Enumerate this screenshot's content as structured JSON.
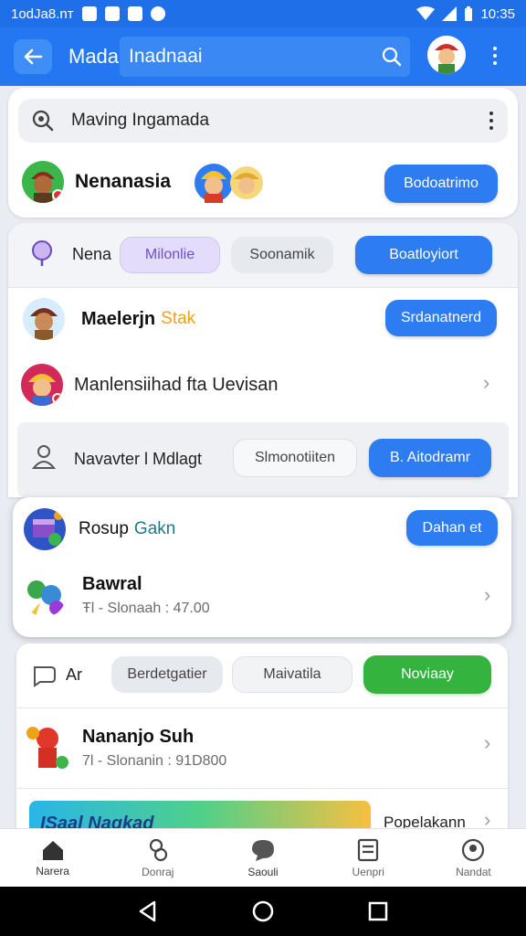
{
  "status_bar": {
    "left_text": "1odJa8.nт",
    "time": "10:35"
  },
  "app_bar": {
    "title": "Mada",
    "search_value": "Inadnaai"
  },
  "search": {
    "value": "Maving Ingamada"
  },
  "profile": {
    "name": "Nenanasia",
    "button": "Bodoatrimo"
  },
  "filters1": {
    "label": "Nena",
    "chip1": "Milonlie",
    "chip2": "Soonamik",
    "chip3": "Boatloyiort"
  },
  "person1": {
    "name": "Maelerjn",
    "tag": "Stak",
    "button": "Srdanatnerd"
  },
  "person2": {
    "name": "Manlensiihad fta Uevisan"
  },
  "filters2": {
    "label": "Navavter l Mdlagt",
    "chip1": "Slmonotiiten",
    "chip2": "B. Aitodramr"
  },
  "group": {
    "title": "Rosup",
    "title_accent": "Gakn",
    "button": "Dahan et"
  },
  "item_bawral": {
    "name": "Bawral",
    "sub": "Ŧl - Slonaah : 47.00"
  },
  "filters3": {
    "label": "Ar",
    "chip1": "Berdetgatier",
    "chip2": "Maivatila",
    "chip3": "Noviaay"
  },
  "item_nananjo": {
    "name": "Nananjo Suh",
    "sub": "7l - Slonanin : 91D800"
  },
  "banner": {
    "text": "ISaal Nagkad",
    "side_label": "Popelakann"
  },
  "bottom_nav": [
    "Narera",
    "Donraj",
    "Saouli",
    "Uenpri",
    "Nandat"
  ],
  "colors": {
    "primary": "#2477f0",
    "accent_green": "#34b33f",
    "chip_purple": "#e4dcfb",
    "chip_gray": "#eef0f3"
  }
}
